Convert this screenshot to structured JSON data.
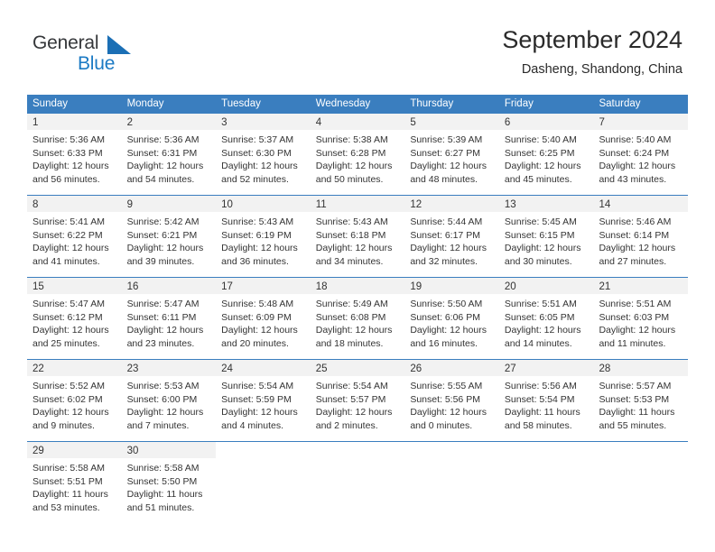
{
  "brand": {
    "name_part1": "General",
    "name_part2": "Blue",
    "triangle_color": "#1b6fb5",
    "blue_color": "#1b7ac4"
  },
  "header": {
    "title": "September 2024",
    "subtitle": "Dasheng, Shandong, China"
  },
  "theme": {
    "header_blue": "#3a7ebf",
    "daynum_bg": "#f2f2f2",
    "text": "#333333"
  },
  "weekdays": [
    "Sunday",
    "Monday",
    "Tuesday",
    "Wednesday",
    "Thursday",
    "Friday",
    "Saturday"
  ],
  "weeks": [
    [
      {
        "day": "1",
        "sunrise": "Sunrise: 5:36 AM",
        "sunset": "Sunset: 6:33 PM",
        "daylight1": "Daylight: 12 hours",
        "daylight2": "and 56 minutes."
      },
      {
        "day": "2",
        "sunrise": "Sunrise: 5:36 AM",
        "sunset": "Sunset: 6:31 PM",
        "daylight1": "Daylight: 12 hours",
        "daylight2": "and 54 minutes."
      },
      {
        "day": "3",
        "sunrise": "Sunrise: 5:37 AM",
        "sunset": "Sunset: 6:30 PM",
        "daylight1": "Daylight: 12 hours",
        "daylight2": "and 52 minutes."
      },
      {
        "day": "4",
        "sunrise": "Sunrise: 5:38 AM",
        "sunset": "Sunset: 6:28 PM",
        "daylight1": "Daylight: 12 hours",
        "daylight2": "and 50 minutes."
      },
      {
        "day": "5",
        "sunrise": "Sunrise: 5:39 AM",
        "sunset": "Sunset: 6:27 PM",
        "daylight1": "Daylight: 12 hours",
        "daylight2": "and 48 minutes."
      },
      {
        "day": "6",
        "sunrise": "Sunrise: 5:40 AM",
        "sunset": "Sunset: 6:25 PM",
        "daylight1": "Daylight: 12 hours",
        "daylight2": "and 45 minutes."
      },
      {
        "day": "7",
        "sunrise": "Sunrise: 5:40 AM",
        "sunset": "Sunset: 6:24 PM",
        "daylight1": "Daylight: 12 hours",
        "daylight2": "and 43 minutes."
      }
    ],
    [
      {
        "day": "8",
        "sunrise": "Sunrise: 5:41 AM",
        "sunset": "Sunset: 6:22 PM",
        "daylight1": "Daylight: 12 hours",
        "daylight2": "and 41 minutes."
      },
      {
        "day": "9",
        "sunrise": "Sunrise: 5:42 AM",
        "sunset": "Sunset: 6:21 PM",
        "daylight1": "Daylight: 12 hours",
        "daylight2": "and 39 minutes."
      },
      {
        "day": "10",
        "sunrise": "Sunrise: 5:43 AM",
        "sunset": "Sunset: 6:19 PM",
        "daylight1": "Daylight: 12 hours",
        "daylight2": "and 36 minutes."
      },
      {
        "day": "11",
        "sunrise": "Sunrise: 5:43 AM",
        "sunset": "Sunset: 6:18 PM",
        "daylight1": "Daylight: 12 hours",
        "daylight2": "and 34 minutes."
      },
      {
        "day": "12",
        "sunrise": "Sunrise: 5:44 AM",
        "sunset": "Sunset: 6:17 PM",
        "daylight1": "Daylight: 12 hours",
        "daylight2": "and 32 minutes."
      },
      {
        "day": "13",
        "sunrise": "Sunrise: 5:45 AM",
        "sunset": "Sunset: 6:15 PM",
        "daylight1": "Daylight: 12 hours",
        "daylight2": "and 30 minutes."
      },
      {
        "day": "14",
        "sunrise": "Sunrise: 5:46 AM",
        "sunset": "Sunset: 6:14 PM",
        "daylight1": "Daylight: 12 hours",
        "daylight2": "and 27 minutes."
      }
    ],
    [
      {
        "day": "15",
        "sunrise": "Sunrise: 5:47 AM",
        "sunset": "Sunset: 6:12 PM",
        "daylight1": "Daylight: 12 hours",
        "daylight2": "and 25 minutes."
      },
      {
        "day": "16",
        "sunrise": "Sunrise: 5:47 AM",
        "sunset": "Sunset: 6:11 PM",
        "daylight1": "Daylight: 12 hours",
        "daylight2": "and 23 minutes."
      },
      {
        "day": "17",
        "sunrise": "Sunrise: 5:48 AM",
        "sunset": "Sunset: 6:09 PM",
        "daylight1": "Daylight: 12 hours",
        "daylight2": "and 20 minutes."
      },
      {
        "day": "18",
        "sunrise": "Sunrise: 5:49 AM",
        "sunset": "Sunset: 6:08 PM",
        "daylight1": "Daylight: 12 hours",
        "daylight2": "and 18 minutes."
      },
      {
        "day": "19",
        "sunrise": "Sunrise: 5:50 AM",
        "sunset": "Sunset: 6:06 PM",
        "daylight1": "Daylight: 12 hours",
        "daylight2": "and 16 minutes."
      },
      {
        "day": "20",
        "sunrise": "Sunrise: 5:51 AM",
        "sunset": "Sunset: 6:05 PM",
        "daylight1": "Daylight: 12 hours",
        "daylight2": "and 14 minutes."
      },
      {
        "day": "21",
        "sunrise": "Sunrise: 5:51 AM",
        "sunset": "Sunset: 6:03 PM",
        "daylight1": "Daylight: 12 hours",
        "daylight2": "and 11 minutes."
      }
    ],
    [
      {
        "day": "22",
        "sunrise": "Sunrise: 5:52 AM",
        "sunset": "Sunset: 6:02 PM",
        "daylight1": "Daylight: 12 hours",
        "daylight2": "and 9 minutes."
      },
      {
        "day": "23",
        "sunrise": "Sunrise: 5:53 AM",
        "sunset": "Sunset: 6:00 PM",
        "daylight1": "Daylight: 12 hours",
        "daylight2": "and 7 minutes."
      },
      {
        "day": "24",
        "sunrise": "Sunrise: 5:54 AM",
        "sunset": "Sunset: 5:59 PM",
        "daylight1": "Daylight: 12 hours",
        "daylight2": "and 4 minutes."
      },
      {
        "day": "25",
        "sunrise": "Sunrise: 5:54 AM",
        "sunset": "Sunset: 5:57 PM",
        "daylight1": "Daylight: 12 hours",
        "daylight2": "and 2 minutes."
      },
      {
        "day": "26",
        "sunrise": "Sunrise: 5:55 AM",
        "sunset": "Sunset: 5:56 PM",
        "daylight1": "Daylight: 12 hours",
        "daylight2": "and 0 minutes."
      },
      {
        "day": "27",
        "sunrise": "Sunrise: 5:56 AM",
        "sunset": "Sunset: 5:54 PM",
        "daylight1": "Daylight: 11 hours",
        "daylight2": "and 58 minutes."
      },
      {
        "day": "28",
        "sunrise": "Sunrise: 5:57 AM",
        "sunset": "Sunset: 5:53 PM",
        "daylight1": "Daylight: 11 hours",
        "daylight2": "and 55 minutes."
      }
    ],
    [
      {
        "day": "29",
        "sunrise": "Sunrise: 5:58 AM",
        "sunset": "Sunset: 5:51 PM",
        "daylight1": "Daylight: 11 hours",
        "daylight2": "and 53 minutes."
      },
      {
        "day": "30",
        "sunrise": "Sunrise: 5:58 AM",
        "sunset": "Sunset: 5:50 PM",
        "daylight1": "Daylight: 11 hours",
        "daylight2": "and 51 minutes."
      },
      {
        "day": "",
        "sunrise": "",
        "sunset": "",
        "daylight1": "",
        "daylight2": ""
      },
      {
        "day": "",
        "sunrise": "",
        "sunset": "",
        "daylight1": "",
        "daylight2": ""
      },
      {
        "day": "",
        "sunrise": "",
        "sunset": "",
        "daylight1": "",
        "daylight2": ""
      },
      {
        "day": "",
        "sunrise": "",
        "sunset": "",
        "daylight1": "",
        "daylight2": ""
      },
      {
        "day": "",
        "sunrise": "",
        "sunset": "",
        "daylight1": "",
        "daylight2": ""
      }
    ]
  ]
}
